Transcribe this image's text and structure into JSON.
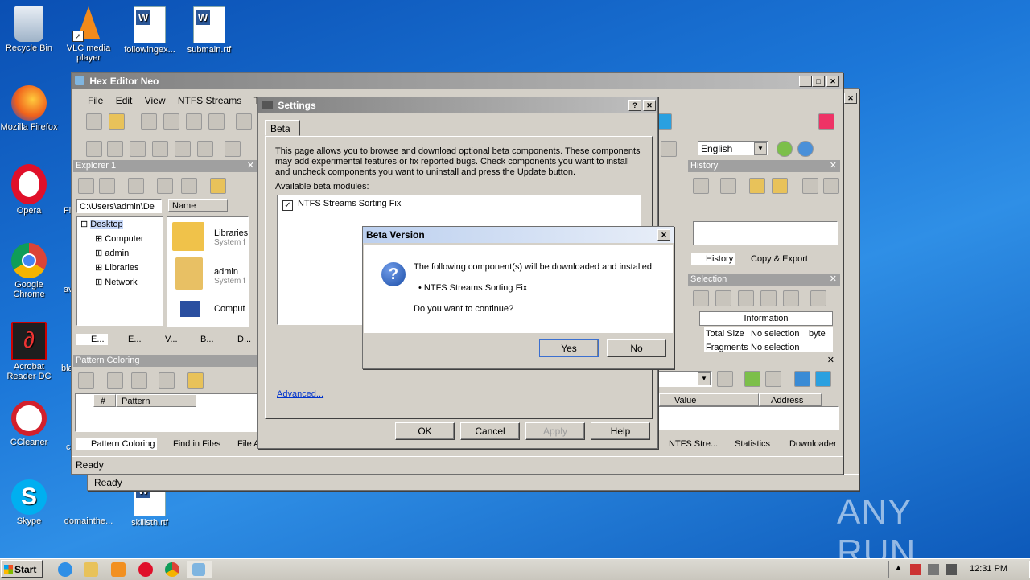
{
  "desktop": {
    "icons": [
      {
        "label": "Recycle Bin"
      },
      {
        "label": "VLC media player"
      },
      {
        "label": "followingex..."
      },
      {
        "label": "submain.rtf"
      },
      {
        "label": "Mozilla Firefox"
      },
      {
        "label": "Opera"
      },
      {
        "label": "Google Chrome"
      },
      {
        "label": "Acrobat Reader DC"
      },
      {
        "label": "CCleaner"
      },
      {
        "label": "Skype"
      },
      {
        "label": "domainthe..."
      },
      {
        "label": "skillsth.rtf"
      }
    ],
    "partial_labels": [
      "Fi",
      "av",
      "bla",
      "c"
    ],
    "watermark": "ANY RUN"
  },
  "main_window": {
    "title": "Hex Editor Neo",
    "menu": [
      "File",
      "Edit",
      "View",
      "NTFS Streams",
      "Tools"
    ],
    "language": "English",
    "explorer": {
      "header": "Explorer 1",
      "path": "C:\\Users\\admin\\De",
      "column": "Name",
      "tree": [
        "Desktop",
        "Computer",
        "admin",
        "Libraries",
        "Network"
      ],
      "items": [
        {
          "name": "Libraries",
          "sub": "System f"
        },
        {
          "name": "admin",
          "sub": "System f"
        },
        {
          "name": "Comput",
          "sub": ""
        }
      ],
      "tabs": [
        "E...",
        "E...",
        "V...",
        "B...",
        "D..."
      ]
    },
    "pattern": {
      "header": "Pattern Coloring",
      "columns": [
        "#",
        "Pattern"
      ],
      "tabs": [
        "Pattern Coloring",
        "Find in Files",
        "File At"
      ]
    },
    "history": {
      "header": "History",
      "tabs": [
        "History",
        "Copy & Export"
      ]
    },
    "selection": {
      "header": "Selection",
      "info_header": "Information",
      "rows": [
        {
          "k": "Total Size",
          "v": "No selection",
          "x": "byte"
        },
        {
          "k": "Fragments",
          "v": "No selection",
          "x": ""
        }
      ]
    },
    "right_bottom": {
      "columns": [
        "Value",
        "Address"
      ],
      "tabs": [
        "NTFS Stre...",
        "Statistics",
        "Downloader"
      ]
    },
    "status": "Ready",
    "status_back": "Ready"
  },
  "settings": {
    "title": "Settings",
    "tab": "Beta",
    "description": "This page allows you to browse and download optional beta components. These components may add experimental features or fix reported bugs. Check components you want to install and uncheck components you want to uninstall and press the Update button.",
    "modules_label": "Available beta modules:",
    "modules": [
      {
        "name": "NTFS Streams Sorting Fix",
        "checked": true
      }
    ],
    "advanced_link": "Advanced...",
    "buttons": {
      "ok": "OK",
      "cancel": "Cancel",
      "apply": "Apply",
      "help": "Help"
    }
  },
  "dialog": {
    "title": "Beta Version",
    "message": "The following component(s) will be downloaded and installed:",
    "component": "• NTFS Streams Sorting Fix",
    "question": "Do you want to continue?",
    "yes": "Yes",
    "no": "No"
  },
  "taskbar": {
    "start": "Start",
    "time": "12:31 PM"
  }
}
